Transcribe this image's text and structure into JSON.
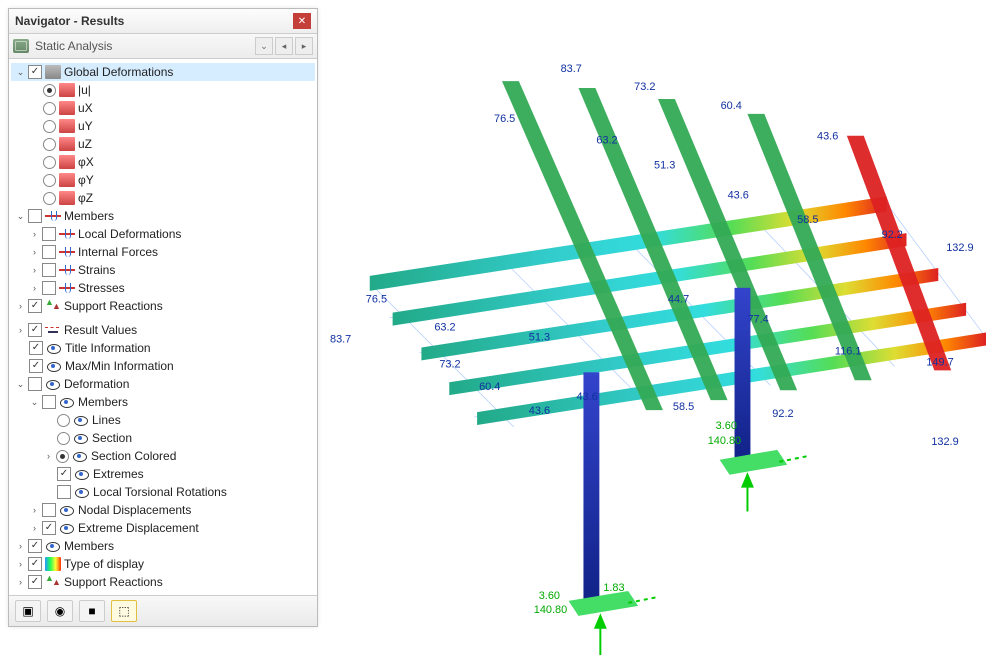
{
  "panel": {
    "title": "Navigator - Results",
    "analysis_type": "Static Analysis"
  },
  "tree": {
    "global_deformations": {
      "label": "Global Deformations",
      "items": {
        "u": "|u|",
        "ux": "uX",
        "uy": "uY",
        "uz": "uZ",
        "phix": "φX",
        "phiy": "φY",
        "phiz": "φZ"
      }
    },
    "members": {
      "label": "Members",
      "local_def": "Local Deformations",
      "internal_forces": "Internal Forces",
      "strains": "Strains",
      "stresses": "Stresses"
    },
    "support_reactions": "Support Reactions",
    "result_values": "Result Values",
    "title_info": "Title Information",
    "maxmin_info": "Max/Min Information",
    "deformation": {
      "label": "Deformation",
      "members": "Members",
      "lines": "Lines",
      "section": "Section",
      "section_colored": "Section Colored",
      "extremes": "Extremes",
      "local_torsional": "Local Torsional Rotations",
      "nodal_disp": "Nodal Displacements",
      "extreme_disp": "Extreme Displacement"
    },
    "members2": "Members",
    "type_display": "Type of display",
    "support_reactions2": "Support Reactions"
  },
  "viewport_labels": {
    "top": [
      "83.7",
      "73.2",
      "60.4",
      "43.6"
    ],
    "row1": [
      "76.5",
      "63.2",
      "51.3"
    ],
    "row2": [
      "43.6",
      "58.5",
      "92.2",
      "132.9"
    ],
    "left": [
      "76.5",
      "83.7"
    ],
    "row3": [
      "63.2",
      "51.3",
      "44.7",
      "77.4",
      "116.1",
      "149.7"
    ],
    "row4": [
      "73.2",
      "60.4",
      "43.6",
      "43.6",
      "58.5",
      "92.2",
      "132.9"
    ],
    "col": [
      "3.60",
      "1.83",
      "140.80",
      "3.60",
      "140.80"
    ]
  }
}
